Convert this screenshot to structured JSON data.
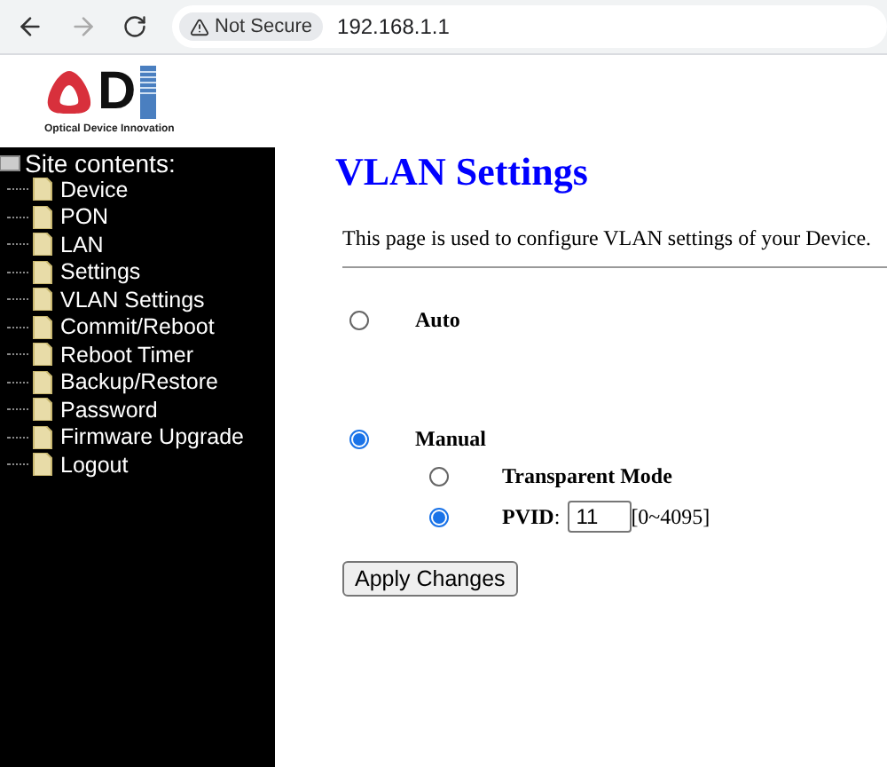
{
  "browser": {
    "security_label": "Not Secure",
    "url": "192.168.1.1"
  },
  "logo": {
    "letter": "D",
    "tagline": "Optical Device Innovation"
  },
  "sidebar": {
    "title": "Site contents:",
    "items": [
      {
        "label": "Device"
      },
      {
        "label": "PON"
      },
      {
        "label": "LAN"
      },
      {
        "label": "Settings"
      },
      {
        "label": "VLAN Settings"
      },
      {
        "label": "Commit/Reboot"
      },
      {
        "label": "Reboot Timer"
      },
      {
        "label": "Backup/Restore"
      },
      {
        "label": "Password"
      },
      {
        "label": "Firmware Upgrade"
      },
      {
        "label": "Logout"
      }
    ]
  },
  "page": {
    "title": "VLAN Settings",
    "description": "This page is used to configure VLAN settings of your Device.",
    "modes": [
      {
        "label": "Auto",
        "selected": false
      },
      {
        "label": "Manual",
        "selected": true
      }
    ],
    "manual_options": [
      {
        "kind": "plain",
        "label": "Transparent Mode",
        "selected": false
      },
      {
        "kind": "field",
        "label": "**PVID**:",
        "value": "11",
        "range": "[0~4095]",
        "selected": true
      }
    ],
    "apply_button": "Apply Changes"
  }
}
